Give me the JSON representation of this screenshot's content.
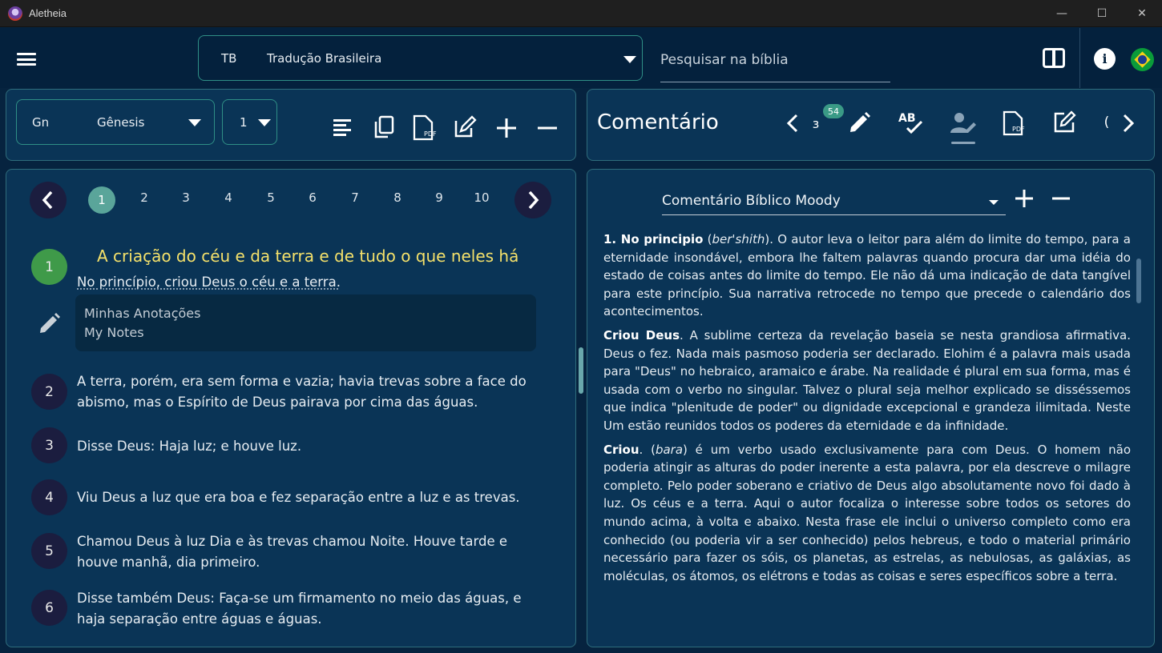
{
  "window": {
    "title": "Aletheia",
    "controls": [
      "—",
      "☐",
      "✕"
    ]
  },
  "topbar": {
    "version_abbr": "TB",
    "version_name": "Tradução Brasileira",
    "search_placeholder": "Pesquisar na bíblia"
  },
  "reader": {
    "book_abbr": "Gn",
    "book_name": "Gênesis",
    "chapter": "1",
    "pages": [
      "1",
      "2",
      "3",
      "4",
      "5",
      "6",
      "7",
      "8",
      "9",
      "10"
    ],
    "active_page": "1",
    "section_heading": "A criação do céu e da terra e de tudo o que neles há",
    "notes": {
      "line1": "Minhas Anotações",
      "line2": "My Notes"
    },
    "verses": [
      {
        "num": "1",
        "text": "No princípio, criou Deus o céu e a terra."
      },
      {
        "num": "2",
        "text": "A terra, porém, era sem forma e vazia; havia trevas sobre a face do abismo, mas o Espírito de Deus pairava por cima das águas."
      },
      {
        "num": "3",
        "text": "Disse Deus: Haja luz; e houve luz."
      },
      {
        "num": "4",
        "text": "Viu Deus a luz que era boa e fez separação entre a luz e as trevas."
      },
      {
        "num": "5",
        "text": "Chamou Deus à luz Dia e às trevas chamou Noite. Houve tarde e houve manhã, dia primeiro."
      },
      {
        "num": "6",
        "text": "Disse também Deus: Faça-se um firmamento no meio das águas, e haja separação entre águas e águas."
      }
    ]
  },
  "commentary": {
    "title": "Comentário",
    "badge": "54",
    "source": "Comentário Bíblico Moody",
    "p1": {
      "head": "1. No principio",
      "open": " (",
      "term": "ber'shith",
      "rest": "). O autor leva o leitor para além do limite do tempo, para a eternidade insondável, embora lhe faltem palavras quando procura dar uma idéia do estado de coisas antes do limite do tempo. Ele não dá uma indicação de data tangível para este princípio. Sua narrativa retrocede no tempo que precede o calendário dos acontecimentos."
    },
    "p2": {
      "head": "Criou Deus",
      "rest": ". A sublime certeza da revelação baseia se nesta grandiosa afirmativa. Deus o fez. Nada mais pasmoso poderia ser declarado. Elohim é a palavra mais usada para \"Deus\" no hebraico, aramaico e árabe. Na realidade é plural em sua forma, mas é usada com o verbo no singular. Talvez o plural seja melhor explicado se disséssemos que indica \"plenitude de poder\" ou dignidade excepcional e grandeza ilimitada. Neste Um estão reunidos todos os poderes da eternidade e da infinidade."
    },
    "p3": {
      "head": "Criou",
      "open": ". (",
      "term": "bara",
      "rest": ") é um verbo usado exclusivamente para com Deus. O homem não poderia atingir as alturas do poder inerente a esta palavra, por ela descreve o milagre completo. Pelo poder soberano e criativo de Deus algo absolutamente novo foi dado à luz. Os céus e a terra. Aqui o autor focaliza o interesse sobre todos os setores do mundo acima, à volta e abaixo. Nesta frase ele inclui o universo completo como era conhecido (ou poderia vir a ser conhecido) pelos hebreus, e todo o material primário necessário para fazer os sóis, os planetas, as estrelas, as nebulosas, as galáxias, as moléculas, os átomos, os elétrons e todas as coisas e seres específicos sobre a terra."
    }
  },
  "colors": {
    "background": "#06233f",
    "panel": "#0a3456",
    "accent": "#2f8f86",
    "heading": "#f5e16a",
    "active_verse": "#3f9a49",
    "active_page": "#5aa59a"
  }
}
